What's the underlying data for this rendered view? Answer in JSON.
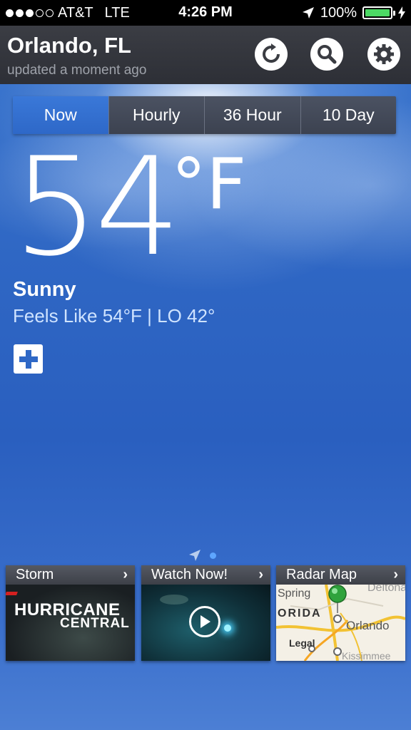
{
  "status": {
    "carrier": "AT&T",
    "network": "LTE",
    "time": "4:26 PM",
    "battery": "100%",
    "signal_bars": 3,
    "signal_total": 5
  },
  "header": {
    "city": "Orlando, FL",
    "updated": "updated a moment ago"
  },
  "tabs": [
    "Now",
    "Hourly",
    "36 Hour",
    "10 Day"
  ],
  "current": {
    "temp": "54",
    "unit": "°F",
    "condition": "Sunny",
    "feels": "Feels Like 54°F |  LO 42°"
  },
  "cards": {
    "storm": {
      "title": "Storm",
      "line1": "HURRICANE",
      "line2": "CENTRAL"
    },
    "watch": {
      "title": "Watch Now!"
    },
    "radar": {
      "title": "Radar Map",
      "places": [
        "Spring",
        "ORIDA",
        "Orlando",
        "Legal",
        "Deltona",
        "Kissimmee"
      ]
    }
  },
  "colors": {
    "accent": "#2e6ac8",
    "header_bg": "#32343b",
    "battery": "#4cd964"
  }
}
